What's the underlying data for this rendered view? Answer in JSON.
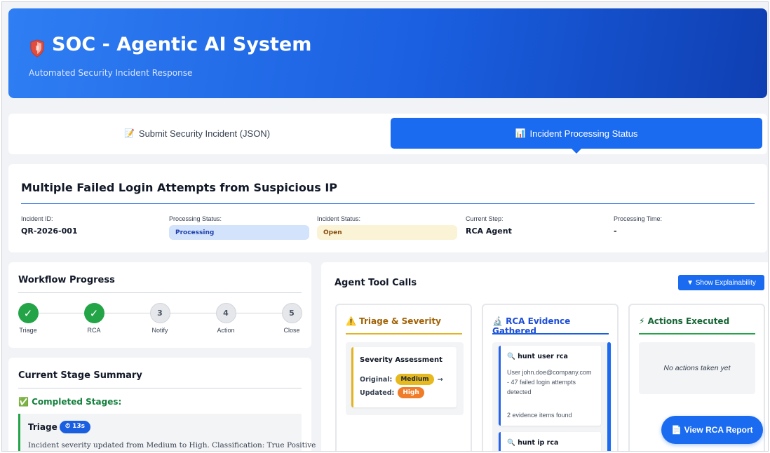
{
  "header": {
    "title": "SOC - Agentic AI System",
    "subtitle": "Automated Security Incident Response"
  },
  "tabs": [
    {
      "icon": "memo-icon",
      "glyph": "📝",
      "label": "Submit Security Incident (JSON)",
      "active": false
    },
    {
      "icon": "chart-icon",
      "glyph": "📊",
      "label": "Incident Processing Status",
      "active": true
    }
  ],
  "incident": {
    "title": "Multiple Failed Login Attempts from Suspicious IP",
    "fields": {
      "id": {
        "label": "Incident ID:",
        "value": "QR-2026-001"
      },
      "processing": {
        "label": "Processing Status:",
        "value": "Processing"
      },
      "status": {
        "label": "Incident Status:",
        "value": "Open"
      },
      "step": {
        "label": "Current Step:",
        "value": "RCA Agent"
      },
      "time": {
        "label": "Processing Time:",
        "value": "-"
      }
    }
  },
  "workflow": {
    "title": "Workflow Progress",
    "steps": [
      {
        "mark": "✓",
        "label": "Triage",
        "done": true
      },
      {
        "mark": "✓",
        "label": "RCA",
        "done": true
      },
      {
        "mark": "3",
        "label": "Notify",
        "done": false
      },
      {
        "mark": "4",
        "label": "Action",
        "done": false
      },
      {
        "mark": "5",
        "label": "Close",
        "done": false
      }
    ]
  },
  "summary": {
    "title": "Current Stage Summary",
    "completed_heading": "✅ Completed Stages:",
    "stage": {
      "name": "Triage",
      "time": "⏱ 13s",
      "description": "Incident severity updated from Medium to High. Classification: True Positive"
    }
  },
  "tools": {
    "title": "Agent Tool Calls",
    "explain_button": "▼ Show Explainability",
    "triage": {
      "heading": "⚠️ Triage & Severity",
      "card_title": "Severity Assessment",
      "original_label": "Original:",
      "original_value": "Medium",
      "arrow": "→",
      "updated_label": "Updated:",
      "updated_value": "High"
    },
    "rca": {
      "heading": "🔬 RCA Evidence Gathered",
      "items": [
        {
          "title": "🔍 hunt user rca",
          "body": "User john.doe@company.com - 47 failed login attempts detected",
          "count": "2 evidence items found"
        },
        {
          "title": "🔍 hunt ip rca",
          "body": "",
          "count": ""
        }
      ]
    },
    "actions": {
      "heading": "⚡ Actions Executed",
      "empty": "No actions taken yet"
    }
  },
  "rca_report_button": "📄 View RCA Report",
  "colors": {
    "primary": "#1a6bf0",
    "success": "#22a447",
    "warning": "#e4b321",
    "high": "#f07c2a"
  }
}
